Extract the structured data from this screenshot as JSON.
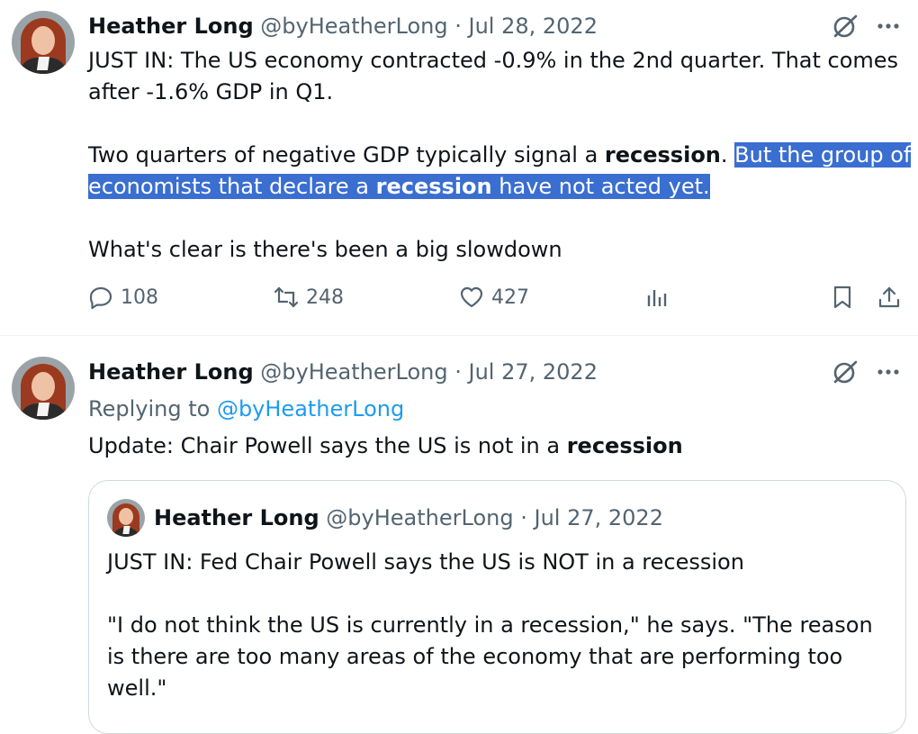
{
  "tweets": [
    {
      "author_name": "Heather Long",
      "author_handle": "@byHeatherLong",
      "sep": "·",
      "date": "Jul 28, 2022",
      "body": {
        "p1": "JUST IN: The US economy contracted -0.9% in the 2nd quarter. That comes after -1.6% GDP in Q1.",
        "p2_a": "Two quarters of negative GDP typically signal a ",
        "p2_b": "recession",
        "p2_c": ". ",
        "p2_hl_a": "But the group of economists that declare a ",
        "p2_hl_b": "recession",
        "p2_hl_c": " have not acted yet.",
        "p3": "What's clear is there's been a big slowdown"
      },
      "stats": {
        "replies": "108",
        "retweets": "248",
        "likes": "427"
      },
      "icons": [
        "grok-icon",
        "more-icon",
        "reply-icon",
        "retweet-icon",
        "like-icon",
        "analytics-icon",
        "bookmark-icon",
        "share-icon"
      ]
    },
    {
      "author_name": "Heather Long",
      "author_handle": "@byHeatherLong",
      "sep": "·",
      "date": "Jul 27, 2022",
      "replying_label": "Replying to ",
      "replying_handle": "@byHeatherLong",
      "body_a": "Update: Chair Powell says the US is not in a ",
      "body_b": "recession",
      "quote": {
        "author_name": "Heather Long",
        "author_handle": "@byHeatherLong",
        "sep": "·",
        "date": "Jul 27, 2022",
        "p1": "JUST IN: Fed Chair Powell says the US is NOT in a recession",
        "p2": "\"I do not think the US is currently in a recession,\" he says. \"The reason is there are too many areas of the economy that are performing too well.\"",
        "p3": "..."
      }
    }
  ],
  "colors": {
    "accent": "#1d9bf0",
    "selection": "#3a6ed1",
    "secondary_text": "#536471",
    "border": "#cfd9de"
  }
}
